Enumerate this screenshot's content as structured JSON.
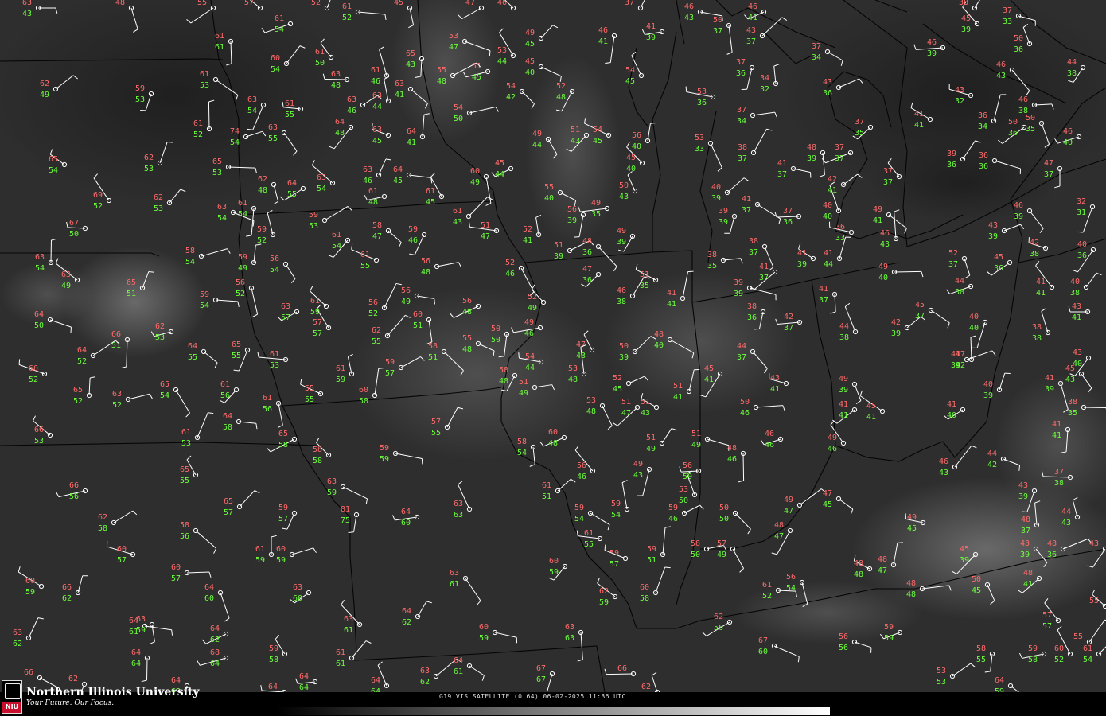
{
  "footer": {
    "university_name": "Northern Illinois University",
    "tagline": "Your Future. Our Focus.",
    "logo_text": "NIU",
    "satellite_label": "G19 VIS SATELLITE (0.64) 06-02-2025 11:36 UTC"
  },
  "colors": {
    "temperature": "#ff6a6a",
    "dewpoint": "#6cff3a",
    "station": "#ffffff",
    "boundary": "#000000"
  },
  "stations": [
    [
      48,
      10,
      "63",
      "43"
    ],
    [
      165,
      10,
      "48",
      ""
    ],
    [
      268,
      10,
      "55",
      ""
    ],
    [
      327,
      10,
      "57",
      ""
    ],
    [
      411,
      10,
      "52",
      ""
    ],
    [
      450,
      15,
      "61",
      "52"
    ],
    [
      515,
      10,
      "45",
      ""
    ],
    [
      605,
      10,
      "47",
      ""
    ],
    [
      645,
      10,
      "46",
      ""
    ],
    [
      805,
      10,
      "37",
      ""
    ],
    [
      880,
      15,
      "46",
      "43"
    ],
    [
      916,
      32,
      "50",
      "37"
    ],
    [
      960,
      15,
      "46",
      "41"
    ],
    [
      1228,
      30,
      "45",
      "39"
    ],
    [
      1225,
      10,
      "38",
      ""
    ],
    [
      1280,
      20,
      "37",
      "33"
    ],
    [
      290,
      52,
      "61",
      "61"
    ],
    [
      365,
      30,
      "61",
      "54"
    ],
    [
      416,
      72,
      "61",
      "50"
    ],
    [
      360,
      80,
      "60",
      "54"
    ],
    [
      584,
      52,
      "53",
      "47"
    ],
    [
      530,
      74,
      "65",
      "43"
    ],
    [
      613,
      90,
      "51",
      "45"
    ],
    [
      645,
      70,
      "53",
      "44"
    ],
    [
      680,
      48,
      "49",
      "45"
    ],
    [
      680,
      84,
      "45",
      "40"
    ],
    [
      772,
      45,
      "46",
      "41"
    ],
    [
      832,
      40,
      "41",
      "39"
    ],
    [
      806,
      95,
      "54",
      "45"
    ],
    [
      958,
      45,
      "43",
      "37"
    ],
    [
      1040,
      65,
      "37",
      "34"
    ],
    [
      945,
      85,
      "37",
      "36"
    ],
    [
      1185,
      60,
      "46",
      "39"
    ],
    [
      1294,
      55,
      "50",
      "36"
    ],
    [
      70,
      112,
      "62",
      "49"
    ],
    [
      271,
      100,
      "61",
      "53"
    ],
    [
      190,
      118,
      "59",
      "53"
    ],
    [
      436,
      100,
      "63",
      "48"
    ],
    [
      486,
      95,
      "61",
      "46"
    ],
    [
      456,
      132,
      "63",
      "46"
    ],
    [
      516,
      112,
      "63",
      "41"
    ],
    [
      331,
      132,
      "63",
      "54"
    ],
    [
      378,
      137,
      "61",
      "55"
    ],
    [
      488,
      127,
      "63",
      "44"
    ],
    [
      569,
      95,
      "55",
      "48"
    ],
    [
      656,
      115,
      "54",
      "42"
    ],
    [
      719,
      115,
      "52",
      "48"
    ],
    [
      896,
      122,
      "53",
      "36"
    ],
    [
      975,
      105,
      "34",
      "32"
    ],
    [
      1054,
      110,
      "43",
      "36"
    ],
    [
      1272,
      88,
      "46",
      "43"
    ],
    [
      1361,
      85,
      "44",
      "38"
    ],
    [
      1220,
      120,
      "43",
      "32"
    ],
    [
      263,
      162,
      "61",
      "52"
    ],
    [
      309,
      172,
      "74",
      "54"
    ],
    [
      357,
      167,
      "63",
      "55"
    ],
    [
      441,
      160,
      "64",
      "48"
    ],
    [
      488,
      170,
      "63",
      "45"
    ],
    [
      531,
      172,
      "64",
      "41"
    ],
    [
      590,
      142,
      "54",
      "50"
    ],
    [
      689,
      175,
      "49",
      "44"
    ],
    [
      737,
      170,
      "51",
      "43"
    ],
    [
      765,
      170,
      "54",
      "45"
    ],
    [
      814,
      177,
      "56",
      "40"
    ],
    [
      946,
      145,
      "37",
      "34"
    ],
    [
      893,
      180,
      "53",
      "33"
    ],
    [
      1094,
      160,
      "37",
      "35"
    ],
    [
      1169,
      150,
      "41",
      "41"
    ],
    [
      1249,
      152,
      "36",
      "34"
    ],
    [
      1300,
      132,
      "46",
      "38"
    ],
    [
      1309,
      155,
      "50",
      "35"
    ],
    [
      1287,
      160,
      "50",
      "36"
    ],
    [
      81,
      207,
      "65",
      "54"
    ],
    [
      201,
      205,
      "62",
      "53"
    ],
    [
      287,
      210,
      "65",
      "53"
    ],
    [
      344,
      232,
      "62",
      "48"
    ],
    [
      381,
      237,
      "64",
      "55"
    ],
    [
      418,
      230,
      "63",
      "54"
    ],
    [
      476,
      220,
      "63",
      "46"
    ],
    [
      514,
      220,
      "64",
      "45"
    ],
    [
      611,
      222,
      "60",
      "49"
    ],
    [
      642,
      212,
      "45",
      "44"
    ],
    [
      807,
      205,
      "45",
      "40"
    ],
    [
      947,
      192,
      "38",
      "37"
    ],
    [
      997,
      212,
      "41",
      "37"
    ],
    [
      1034,
      192,
      "48",
      "39"
    ],
    [
      1069,
      192,
      "37",
      "37"
    ],
    [
      1130,
      222,
      "37",
      "37"
    ],
    [
      1210,
      200,
      "39",
      "36"
    ],
    [
      1250,
      202,
      "36",
      "36"
    ],
    [
      1332,
      212,
      "47",
      "37"
    ],
    [
      1356,
      172,
      "46",
      "40"
    ],
    [
      137,
      252,
      "69",
      "52"
    ],
    [
      213,
      255,
      "62",
      "53"
    ],
    [
      293,
      267,
      "63",
      "54"
    ],
    [
      319,
      262,
      "61",
      "54"
    ],
    [
      483,
      247,
      "61",
      "48"
    ],
    [
      555,
      247,
      "61",
      "45"
    ],
    [
      589,
      272,
      "61",
      "43"
    ],
    [
      704,
      242,
      "55",
      "40"
    ],
    [
      733,
      270,
      "56",
      "39"
    ],
    [
      763,
      262,
      "49",
      "35"
    ],
    [
      798,
      240,
      "50",
      "43"
    ],
    [
      914,
      242,
      "40",
      "39"
    ],
    [
      952,
      257,
      "41",
      "37"
    ],
    [
      923,
      272,
      "39",
      "39"
    ],
    [
      1004,
      272,
      "37",
      "36"
    ],
    [
      1054,
      265,
      "40",
      "40"
    ],
    [
      1060,
      232,
      "42",
      "41"
    ],
    [
      1117,
      270,
      "49",
      "41"
    ],
    [
      1373,
      260,
      "32",
      "31"
    ],
    [
      107,
      287,
      "67",
      "50"
    ],
    [
      343,
      295,
      "59",
      "52"
    ],
    [
      408,
      277,
      "59",
      "53"
    ],
    [
      488,
      290,
      "58",
      "47"
    ],
    [
      533,
      295,
      "59",
      "46"
    ],
    [
      624,
      290,
      "51",
      "47"
    ],
    [
      677,
      295,
      "52",
      "41"
    ],
    [
      716,
      315,
      "51",
      "39"
    ],
    [
      752,
      310,
      "48",
      "36"
    ],
    [
      795,
      297,
      "49",
      "39"
    ],
    [
      1070,
      292,
      "36",
      "33"
    ],
    [
      1126,
      300,
      "46",
      "43"
    ],
    [
      1262,
      290,
      "43",
      "39"
    ],
    [
      1294,
      265,
      "46",
      "39"
    ],
    [
      1374,
      314,
      "40",
      "36"
    ],
    [
      1314,
      312,
      "42",
      "38"
    ],
    [
      64,
      330,
      "63",
      "54"
    ],
    [
      253,
      322,
      "58",
      "54"
    ],
    [
      359,
      332,
      "56",
      "54"
    ],
    [
      437,
      302,
      "61",
      "54"
    ],
    [
      473,
      327,
      "61",
      "55"
    ],
    [
      319,
      330,
      "59",
      "49"
    ],
    [
      549,
      335,
      "56",
      "48"
    ],
    [
      655,
      337,
      "52",
      "46"
    ],
    [
      752,
      345,
      "47",
      "36"
    ],
    [
      824,
      352,
      "51",
      "35"
    ],
    [
      858,
      375,
      "41",
      "41"
    ],
    [
      909,
      327,
      "38",
      "35"
    ],
    [
      961,
      310,
      "38",
      "37"
    ],
    [
      974,
      342,
      "41",
      "37"
    ],
    [
      1022,
      325,
      "41",
      "39"
    ],
    [
      1055,
      325,
      "41",
      "44"
    ],
    [
      1124,
      342,
      "49",
      "40"
    ],
    [
      1212,
      325,
      "52",
      "37"
    ],
    [
      1269,
      330,
      "45",
      "36"
    ],
    [
      97,
      352,
      "63",
      "49"
    ],
    [
      179,
      362,
      "65",
      "51"
    ],
    [
      271,
      377,
      "59",
      "54"
    ],
    [
      316,
      362,
      "56",
      "52"
    ],
    [
      373,
      392,
      "63",
      "57"
    ],
    [
      410,
      385,
      "61",
      "59"
    ],
    [
      483,
      387,
      "56",
      "52"
    ],
    [
      524,
      372,
      "56",
      "49"
    ],
    [
      539,
      402,
      "60",
      "51"
    ],
    [
      601,
      385,
      "56",
      "48"
    ],
    [
      683,
      380,
      "52",
      "49"
    ],
    [
      795,
      372,
      "46",
      "38"
    ],
    [
      942,
      362,
      "39",
      "39"
    ],
    [
      1049,
      370,
      "41",
      "37"
    ],
    [
      1220,
      360,
      "44",
      "38"
    ],
    [
      1322,
      361,
      "41",
      "41"
    ],
    [
      1365,
      361,
      "40",
      "38"
    ],
    [
      63,
      402,
      "64",
      "50"
    ],
    [
      160,
      427,
      "66",
      "51"
    ],
    [
      215,
      417,
      "62",
      "53"
    ],
    [
      413,
      412,
      "57",
      "57"
    ],
    [
      487,
      422,
      "62",
      "55"
    ],
    [
      601,
      432,
      "55",
      "48"
    ],
    [
      637,
      420,
      "50",
      "50"
    ],
    [
      679,
      412,
      "49",
      "46"
    ],
    [
      744,
      440,
      "47",
      "43"
    ],
    [
      798,
      442,
      "50",
      "39"
    ],
    [
      842,
      427,
      "48",
      "40"
    ],
    [
      959,
      392,
      "38",
      "36"
    ],
    [
      1005,
      405,
      "42",
      "37"
    ],
    [
      1075,
      417,
      "44",
      "38"
    ],
    [
      1140,
      412,
      "42",
      "39"
    ],
    [
      1170,
      390,
      "45",
      "37"
    ],
    [
      1238,
      405,
      "40",
      "40"
    ],
    [
      1367,
      392,
      "43",
      "41"
    ],
    [
      1317,
      418,
      "38",
      "38"
    ],
    [
      117,
      447,
      "64",
      "52"
    ],
    [
      256,
      442,
      "64",
      "55"
    ],
    [
      311,
      440,
      "65",
      "55"
    ],
    [
      359,
      452,
      "61",
      "53"
    ],
    [
      442,
      470,
      "61",
      "59"
    ],
    [
      504,
      462,
      "59",
      "57"
    ],
    [
      558,
      442,
      "58",
      "51"
    ],
    [
      647,
      472,
      "58",
      "48"
    ],
    [
      680,
      455,
      "54",
      "44"
    ],
    [
      734,
      470,
      "53",
      "48"
    ],
    [
      790,
      482,
      "52",
      "45"
    ],
    [
      946,
      442,
      "44",
      "37"
    ],
    [
      905,
      470,
      "45",
      "41"
    ],
    [
      988,
      482,
      "43",
      "41"
    ],
    [
      1221,
      452,
      "47",
      "42"
    ],
    [
      1215,
      452,
      "41",
      "39"
    ],
    [
      1359,
      470,
      "45",
      "43"
    ],
    [
      1368,
      450,
      "43",
      "40"
    ],
    [
      56,
      470,
      "60",
      "52"
    ],
    [
      112,
      497,
      "65",
      "52"
    ],
    [
      161,
      502,
      "63",
      "52"
    ],
    [
      221,
      490,
      "65",
      "54"
    ],
    [
      297,
      490,
      "61",
      "56"
    ],
    [
      403,
      495,
      "55",
      "55"
    ],
    [
      471,
      497,
      "60",
      "58"
    ],
    [
      672,
      487,
      "51",
      "49"
    ],
    [
      757,
      510,
      "53",
      "48"
    ],
    [
      801,
      512,
      "51",
      "47"
    ],
    [
      825,
      512,
      "51",
      "43"
    ],
    [
      866,
      492,
      "51",
      "41"
    ],
    [
      950,
      512,
      "50",
      "46"
    ],
    [
      1074,
      483,
      "49",
      "39"
    ],
    [
      1074,
      515,
      "41",
      "41"
    ],
    [
      1109,
      517,
      "45",
      "41"
    ],
    [
      1256,
      490,
      "40",
      "39"
    ],
    [
      1362,
      512,
      "38",
      "35"
    ],
    [
      1333,
      482,
      "41",
      "39"
    ],
    [
      1210,
      515,
      "41",
      "40"
    ],
    [
      63,
      547,
      "66",
      "53"
    ],
    [
      248,
      550,
      "61",
      "53"
    ],
    [
      300,
      530,
      "64",
      "58"
    ],
    [
      350,
      507,
      "61",
      "56"
    ],
    [
      370,
      552,
      "65",
      "58"
    ],
    [
      413,
      572,
      "58",
      "58"
    ],
    [
      562,
      537,
      "57",
      "55"
    ],
    [
      497,
      570,
      "59",
      "59"
    ],
    [
      670,
      562,
      "58",
      "54"
    ],
    [
      709,
      550,
      "60",
      "48"
    ],
    [
      745,
      592,
      "56",
      "46"
    ],
    [
      832,
      557,
      "51",
      "49"
    ],
    [
      889,
      552,
      "51",
      "49"
    ],
    [
      934,
      570,
      "48",
      "46"
    ],
    [
      981,
      552,
      "46",
      "46"
    ],
    [
      1060,
      557,
      "49",
      "46"
    ],
    [
      1200,
      587,
      "46",
      "43"
    ],
    [
      1261,
      577,
      "44",
      "42"
    ],
    [
      1342,
      540,
      "41",
      "41"
    ],
    [
      107,
      617,
      "66",
      "56"
    ],
    [
      246,
      597,
      "65",
      "55"
    ],
    [
      301,
      637,
      "65",
      "57"
    ],
    [
      431,
      612,
      "63",
      "59"
    ],
    [
      448,
      647,
      "81",
      "75"
    ],
    [
      524,
      650,
      "64",
      "60"
    ],
    [
      590,
      640,
      "63",
      "63"
    ],
    [
      701,
      617,
      "61",
      "51"
    ],
    [
      742,
      645,
      "59",
      "54"
    ],
    [
      816,
      590,
      "49",
      "43"
    ],
    [
      878,
      592,
      "56",
      "50"
    ],
    [
      873,
      622,
      "53",
      "50"
    ],
    [
      1005,
      635,
      "49",
      "47"
    ],
    [
      1054,
      627,
      "47",
      "45"
    ],
    [
      1300,
      617,
      "43",
      "39"
    ],
    [
      1345,
      600,
      "37",
      "38"
    ],
    [
      1354,
      650,
      "44",
      "43"
    ],
    [
      143,
      657,
      "62",
      "58"
    ],
    [
      246,
      667,
      "58",
      "56"
    ],
    [
      370,
      645,
      "59",
      "57"
    ],
    [
      754,
      677,
      "61",
      "55"
    ],
    [
      788,
      640,
      "59",
      "54"
    ],
    [
      860,
      645,
      "59",
      "46"
    ],
    [
      924,
      645,
      "50",
      "50"
    ],
    [
      993,
      667,
      "48",
      "47"
    ],
    [
      1160,
      657,
      "49",
      "45"
    ],
    [
      1303,
      660,
      "48",
      "37"
    ],
    [
      1336,
      690,
      "48",
      "36"
    ],
    [
      1302,
      690,
      "43",
      "39"
    ],
    [
      1389,
      690,
      "43",
      ""
    ],
    [
      167,
      697,
      "60",
      "57"
    ],
    [
      341,
      697,
      "61",
      "59"
    ],
    [
      367,
      697,
      "60",
      "59"
    ],
    [
      585,
      727,
      "63",
      "61"
    ],
    [
      710,
      712,
      "60",
      "59"
    ],
    [
      786,
      702,
      "59",
      "57"
    ],
    [
      833,
      697,
      "59",
      "51"
    ],
    [
      888,
      690,
      "58",
      "50"
    ],
    [
      921,
      690,
      "57",
      "49"
    ],
    [
      1226,
      697,
      "45",
      "39"
    ],
    [
      1093,
      715,
      "48",
      "48"
    ],
    [
      1123,
      710,
      "48",
      "47"
    ],
    [
      1159,
      740,
      "48",
      "48"
    ],
    [
      1241,
      735,
      "50",
      "45"
    ],
    [
      1306,
      727,
      "48",
      "41"
    ],
    [
      52,
      737,
      "60",
      "59"
    ],
    [
      98,
      745,
      "66",
      "62"
    ],
    [
      235,
      720,
      "60",
      "57"
    ],
    [
      277,
      745,
      "64",
      "60"
    ],
    [
      388,
      745,
      "63",
      "60"
    ],
    [
      773,
      750,
      "62",
      "59"
    ],
    [
      824,
      745,
      "60",
      "58"
    ],
    [
      978,
      742,
      "61",
      "52"
    ],
    [
      1008,
      732,
      "56",
      "54"
    ],
    [
      917,
      782,
      "62",
      "56"
    ],
    [
      1389,
      762,
      "55",
      ""
    ],
    [
      36,
      802,
      "63",
      "62"
    ],
    [
      182,
      787,
      "64",
      "61"
    ],
    [
      191,
      785,
      "63",
      "59"
    ],
    [
      284,
      797,
      "64",
      "62"
    ],
    [
      452,
      785,
      "63",
      "61"
    ],
    [
      525,
      775,
      "64",
      "62"
    ],
    [
      622,
      795,
      "60",
      "59"
    ],
    [
      730,
      795,
      "63",
      "63"
    ],
    [
      1131,
      795,
      "59",
      "59"
    ],
    [
      1330,
      780,
      "57",
      "57"
    ],
    [
      1369,
      807,
      "55",
      ""
    ],
    [
      1074,
      807,
      "56",
      "56"
    ],
    [
      185,
      827,
      "64",
      "64"
    ],
    [
      284,
      827,
      "68",
      "64"
    ],
    [
      358,
      822,
      "59",
      "58"
    ],
    [
      442,
      827,
      "61",
      "61"
    ],
    [
      973,
      812,
      "67",
      "60"
    ],
    [
      1247,
      822,
      "58",
      "55"
    ],
    [
      1312,
      822,
      "59",
      "58"
    ],
    [
      1345,
      822,
      "60",
      "52"
    ],
    [
      1381,
      822,
      "61",
      "54"
    ],
    [
      50,
      852,
      "66",
      ""
    ],
    [
      235,
      862,
      "64",
      "62"
    ],
    [
      396,
      857,
      "64",
      "64"
    ],
    [
      486,
      862,
      "64",
      "64"
    ],
    [
      548,
      850,
      "63",
      "62"
    ],
    [
      590,
      837,
      "64",
      "61"
    ],
    [
      694,
      847,
      "67",
      "67"
    ],
    [
      796,
      847,
      "66",
      ""
    ],
    [
      826,
      870,
      "62",
      ""
    ],
    [
      1197,
      850,
      "53",
      "53"
    ],
    [
      1270,
      862,
      "64",
      "59"
    ],
    [
      106,
      860,
      "62",
      ""
    ],
    [
      357,
      870,
      "64",
      ""
    ]
  ]
}
